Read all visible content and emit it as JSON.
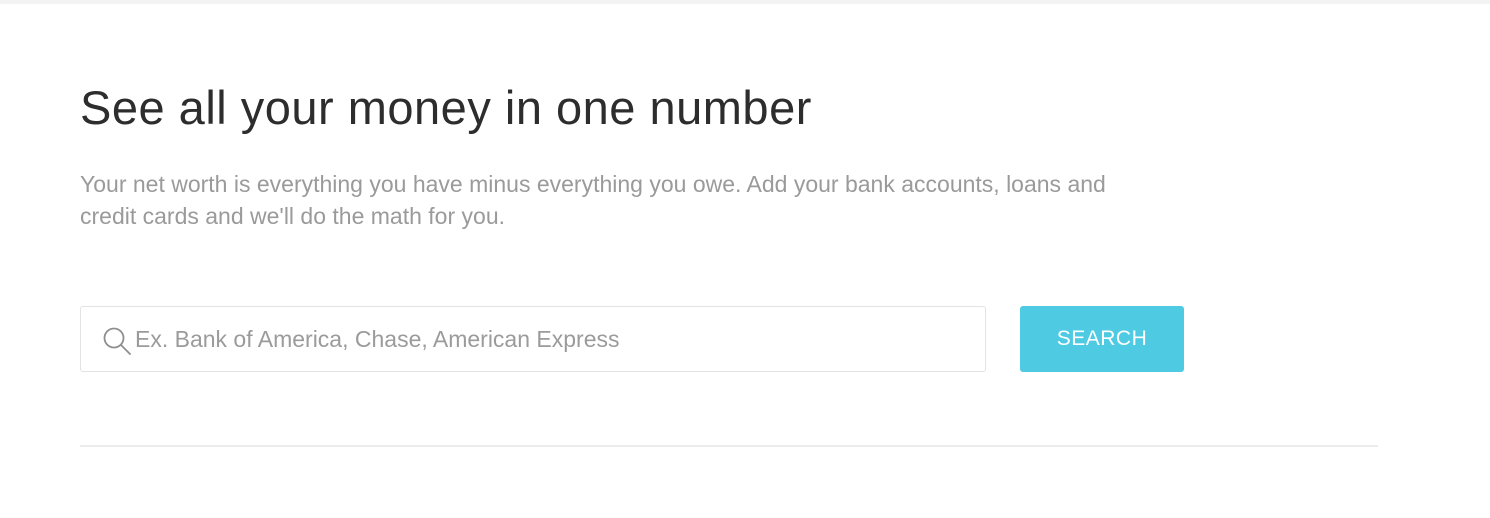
{
  "header": {
    "title": "See all your money in one number",
    "description": "Your net worth is everything you have minus everything you owe. Add your bank accounts, loans and credit cards and we'll do the math for you."
  },
  "search": {
    "placeholder": "Ex. Bank of America, Chase, American Express",
    "value": "",
    "icon": "search-icon",
    "button_label": "SEARCH"
  },
  "colors": {
    "accent": "#4ecbe3",
    "title_text": "#2d2d2d",
    "muted_text": "#9a9a9a"
  }
}
